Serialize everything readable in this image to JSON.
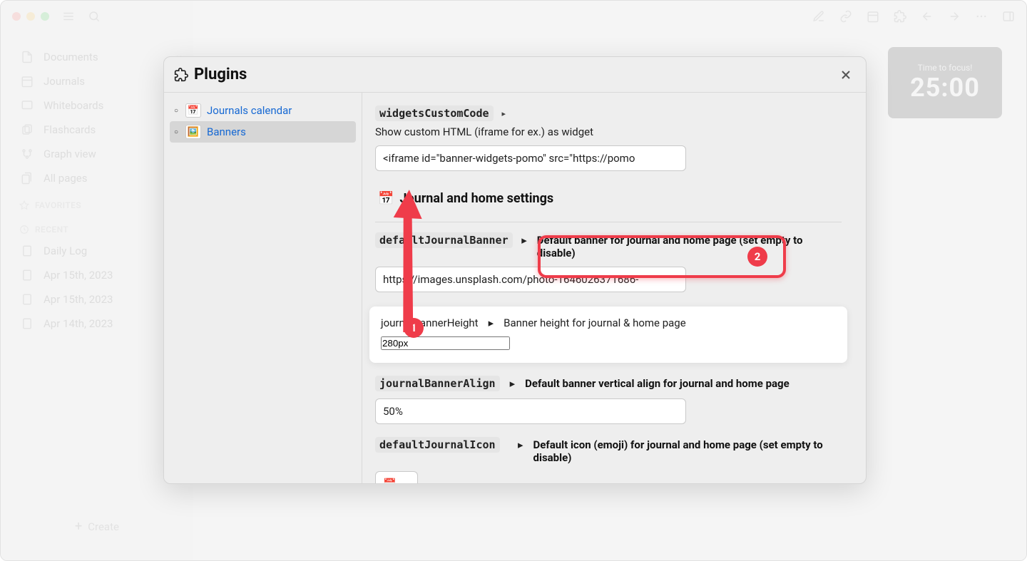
{
  "sidebar": {
    "items": [
      {
        "label": "Documents",
        "icon": "file"
      },
      {
        "label": "Journals",
        "icon": "calendar"
      },
      {
        "label": "Whiteboards",
        "icon": "board"
      },
      {
        "label": "Flashcards",
        "icon": "cards"
      },
      {
        "label": "Graph view",
        "icon": "graph"
      },
      {
        "label": "All pages",
        "icon": "pages"
      }
    ],
    "favorites_label": "FAVORITES",
    "recent_label": "RECENT",
    "recent": [
      {
        "label": "Daily Log"
      },
      {
        "label": "Apr 15th, 2023"
      },
      {
        "label": "Apr 15th, 2023"
      },
      {
        "label": "Apr 14th, 2023"
      }
    ],
    "create_label": "Create"
  },
  "timer": {
    "label": "Time to focus!",
    "time": "25:00"
  },
  "modal": {
    "title": "Plugins",
    "plugins": [
      {
        "label": "Journals calendar",
        "emoji": "📅"
      },
      {
        "label": "Banners",
        "emoji": "🖼️"
      }
    ],
    "settings": {
      "widgetsCustomCode": {
        "key": "widgetsCustomCode",
        "desc": "Show custom HTML (iframe for ex.) as widget",
        "value": "<iframe id=\"banner-widgets-pomo\" src=\"https://pomo"
      },
      "section_heading": "Journal and home settings",
      "defaultJournalBanner": {
        "key": "defaultJournalBanner",
        "desc": "Default banner for journal and home page (set empty to disable)",
        "value": "https://images.unsplash.com/photo-1646026371686-"
      },
      "journalBannerHeight": {
        "key": "journalBannerHeight",
        "desc": "Banner height for journal & home page",
        "value": "280px"
      },
      "journalBannerAlign": {
        "key": "journalBannerAlign",
        "desc": "Default banner vertical align for journal and home page",
        "value": "50%"
      },
      "defaultJournalIcon": {
        "key": "defaultJournalIcon",
        "desc": "Default icon (emoji) for journal and home page (set empty to disable)",
        "value": "📅"
      }
    }
  },
  "annotations": {
    "one": "1",
    "two": "2"
  }
}
